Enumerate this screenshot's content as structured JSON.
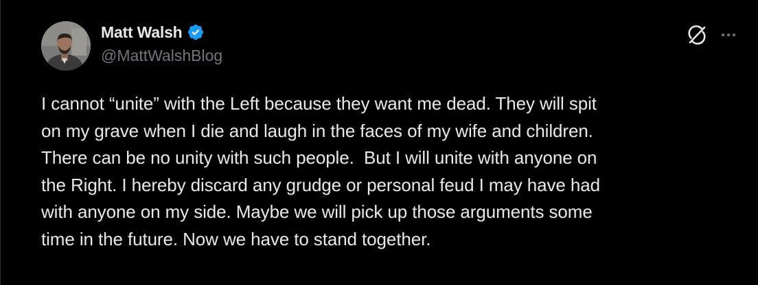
{
  "author": {
    "name": "Matt Walsh",
    "handle": "@MattWalshBlog",
    "verified": true,
    "avatar_icon": "profile-photo"
  },
  "actions": {
    "grok_icon": "grok-icon",
    "more_icon": "more-icon"
  },
  "tweet": {
    "text": "I cannot “unite” with the Left because they want me dead. They will spit\non my grave when I die and laugh in the faces of my wife and children.\nThere can be no unity with such people.  But I will unite with anyone on\nthe Right. I hereby discard any grudge or personal feud I may have had\nwith anyone on my side. Maybe we will pick up those arguments some\ntime in the future. Now we have to stand together."
  },
  "colors": {
    "background": "#000000",
    "text": "#e7e9ea",
    "secondary_text": "#71767b",
    "verified_badge": "#1d9bf0"
  }
}
